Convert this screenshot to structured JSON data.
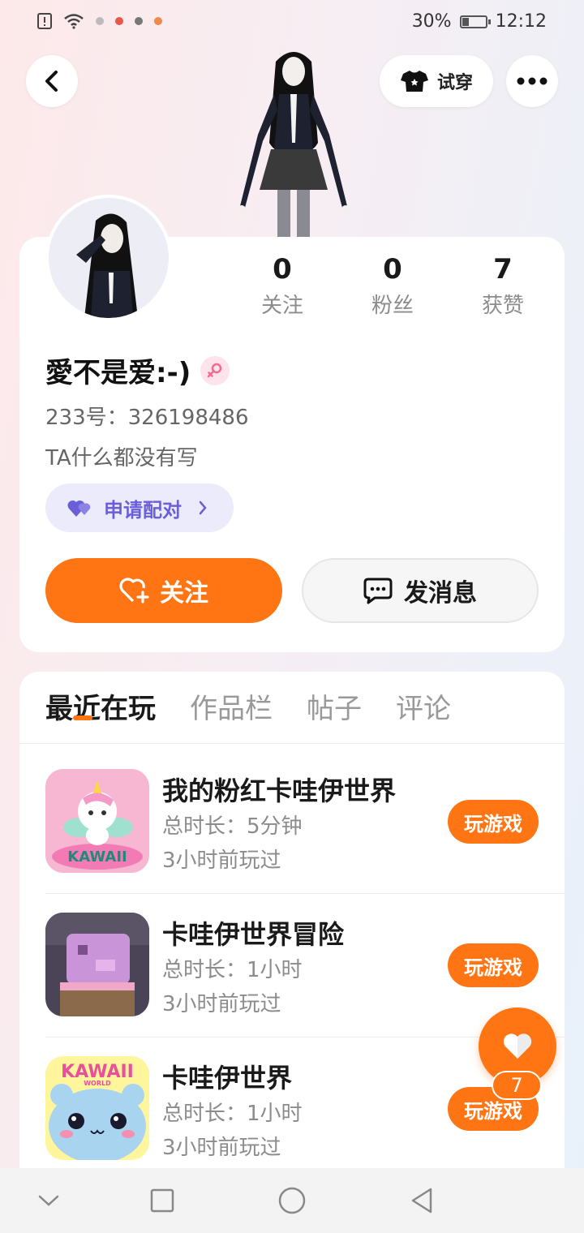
{
  "status_bar": {
    "battery_level": "30%",
    "battery_fraction": 0.3,
    "time": "12:12",
    "left_icons": [
      "alert-icon",
      "wifi-icon",
      "notif-icon-1",
      "notif-icon-2",
      "notif-icon-3",
      "notif-icon-4"
    ]
  },
  "header": {
    "back_icon": "chevron-left-icon",
    "try_on_label": "试穿",
    "try_on_icon": "shirt-icon",
    "more_icon": "more-horizontal-icon"
  },
  "profile": {
    "stats": [
      {
        "value": "0",
        "label": "关注"
      },
      {
        "value": "0",
        "label": "粉丝"
      },
      {
        "value": "7",
        "label": "获赞"
      }
    ],
    "username": "愛不是爱:-)",
    "gender_icon": "female-icon",
    "user_id": "233号：326198486",
    "bio": "TA什么都没有写",
    "pair_label": "申请配对",
    "follow_label": "关注",
    "message_label": "发消息"
  },
  "tabs": [
    {
      "label": "最近在玩",
      "active": true
    },
    {
      "label": "作品栏",
      "active": false
    },
    {
      "label": "帖子",
      "active": false
    },
    {
      "label": "评论",
      "active": false
    }
  ],
  "games": [
    {
      "title": "我的粉红卡哇伊世界",
      "duration": "总时长：5分钟",
      "last_played": "3小时前玩过",
      "play_label": "玩游戏"
    },
    {
      "title": "卡哇伊世界冒险",
      "duration": "总时长：1小时",
      "last_played": "3小时前玩过",
      "play_label": "玩游戏"
    },
    {
      "title": "卡哇伊世界",
      "duration": "总时长：1小时",
      "last_played": "3小时前玩过",
      "play_label": "玩游戏"
    }
  ],
  "game_icon_text": {
    "kawaii_logo": "KAWAII",
    "world_label": "WORLD"
  },
  "like_fab": {
    "icon": "heart-icon",
    "count": "7"
  },
  "nav": {
    "buttons": [
      "chevron-down-icon",
      "square-icon",
      "circle-icon",
      "triangle-back-icon"
    ]
  },
  "colors": {
    "accent": "#ff7514",
    "pair_purple": "#6b5fd8",
    "pair_bg": "#ecebfb"
  }
}
